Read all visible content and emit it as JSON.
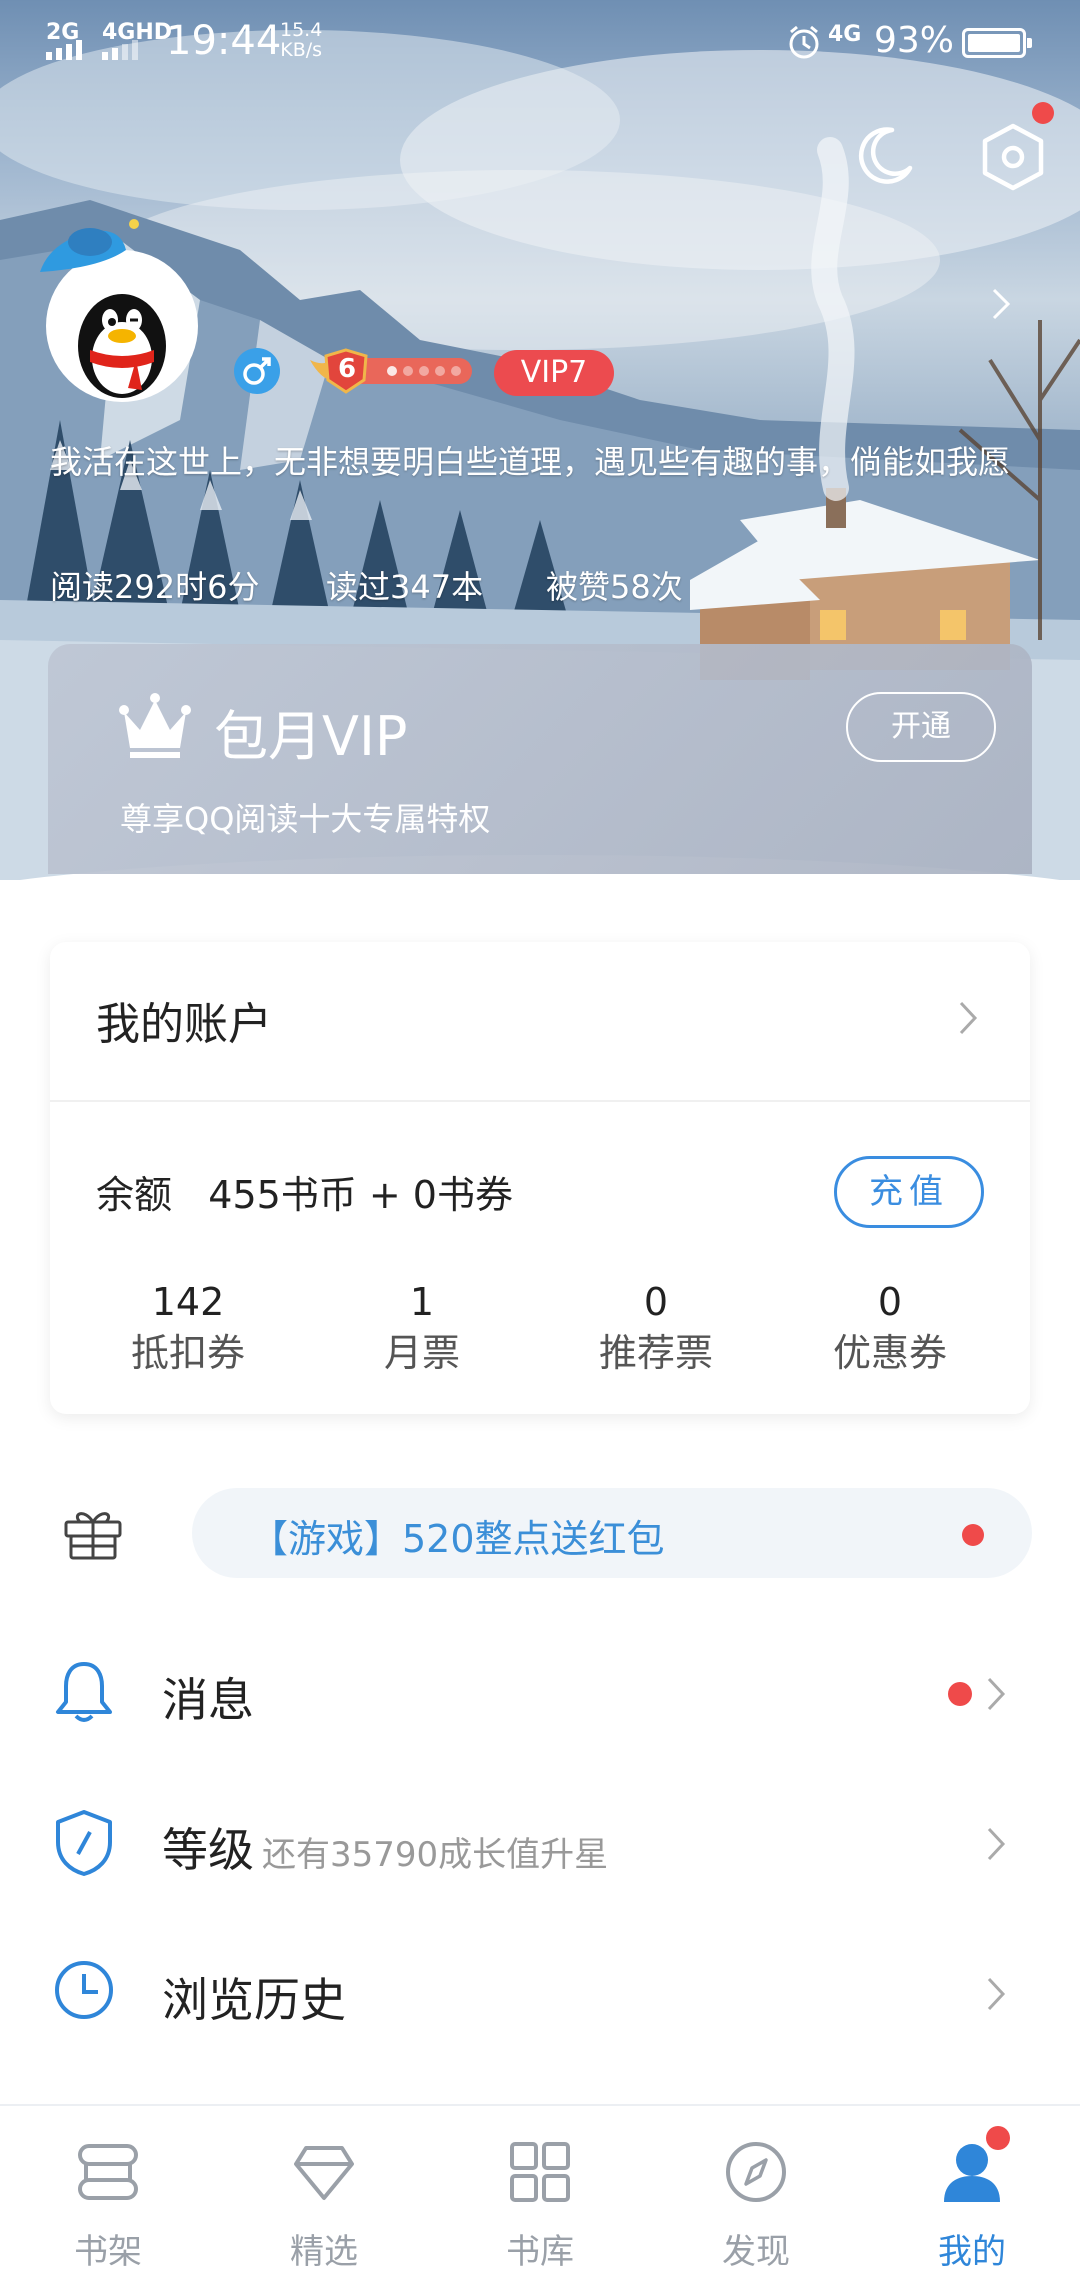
{
  "status_bar": {
    "sig1": "2G",
    "sig2": "4GHD",
    "time": "19:44",
    "net_speed_value": "15.4",
    "net_speed_unit": "KB/s",
    "net_type": "4G",
    "battery": "93%",
    "battery_level": 0.93
  },
  "header": {
    "night_mode_icon": "moon-icon",
    "settings_icon": "hexagon-settings-icon"
  },
  "profile": {
    "gender_icon": "male-icon",
    "level_number": "6",
    "vip_label": "VIP7",
    "signature": "我活在这世上，无非想要明白些道理，遇见些有趣的事，倘能如我愿",
    "stats": {
      "read_time": "阅读292时6分",
      "books_read": "读过347本",
      "likes": "被赞58次"
    }
  },
  "vip_card": {
    "title": "包月VIP",
    "subtitle": "尊享QQ阅读十大专属特权",
    "button": "开通"
  },
  "account": {
    "title": "我的账户",
    "balance_label": "余额",
    "balance_value": "455书币 + 0书券",
    "recharge_button": "充值",
    "stats": [
      {
        "value": "142",
        "label": "抵扣券"
      },
      {
        "value": "1",
        "label": "月票"
      },
      {
        "value": "0",
        "label": "推荐票"
      },
      {
        "value": "0",
        "label": "优惠券"
      }
    ]
  },
  "promo": {
    "text": "【游戏】520整点送红包"
  },
  "menu": [
    {
      "label": "消息",
      "hint": ""
    },
    {
      "label": "等级",
      "hint": "还有35790成长值升星"
    },
    {
      "label": "浏览历史",
      "hint": ""
    }
  ],
  "bottom_nav": [
    {
      "label": "书架",
      "icon": "bookshelf-icon"
    },
    {
      "label": "精选",
      "icon": "diamond-icon"
    },
    {
      "label": "书库",
      "icon": "grid-icon"
    },
    {
      "label": "发现",
      "icon": "compass-icon"
    },
    {
      "label": "我的",
      "icon": "user-icon",
      "active": true
    }
  ],
  "colors": {
    "accent": "#2f86d9",
    "badge_red": "#ef4a4a",
    "vip_red": "#ec4b4f"
  }
}
